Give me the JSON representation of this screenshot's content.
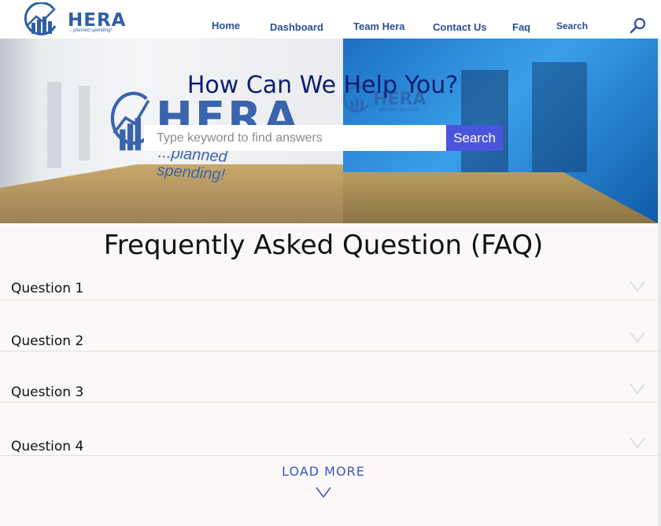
{
  "brand": {
    "name": "HERA",
    "tagline": "...planned spending!",
    "color": "#2f5fa6"
  },
  "nav": {
    "items": [
      {
        "label": "Home"
      },
      {
        "label": "Dashboard"
      },
      {
        "label": "Team Hera"
      },
      {
        "label": "Contact Us"
      },
      {
        "label": "Faq"
      }
    ],
    "search_label": "Search",
    "search_icon": "search-icon"
  },
  "hero": {
    "title": "How Can We Help You?",
    "search_placeholder": "Type keyword to find answers",
    "search_value": "",
    "search_button": "Search",
    "button_color": "#4a55dc",
    "wall_logo": {
      "name": "HERA",
      "tagline": "...planned spending!"
    },
    "glass_logo": {
      "name": "HERA",
      "tagline": "...planned spending!"
    }
  },
  "faq": {
    "title": "Frequently Asked Question (FAQ)",
    "questions": [
      {
        "label": "Question 1",
        "icon": "chevron-down-icon"
      },
      {
        "label": "Question 2",
        "icon": "chevron-down-icon"
      },
      {
        "label": "Question 3",
        "icon": "chevron-down-icon"
      },
      {
        "label": "Question 4",
        "icon": "chevron-down-icon"
      }
    ],
    "load_more": "LOAD MORE",
    "accent": "#3b54c8"
  }
}
